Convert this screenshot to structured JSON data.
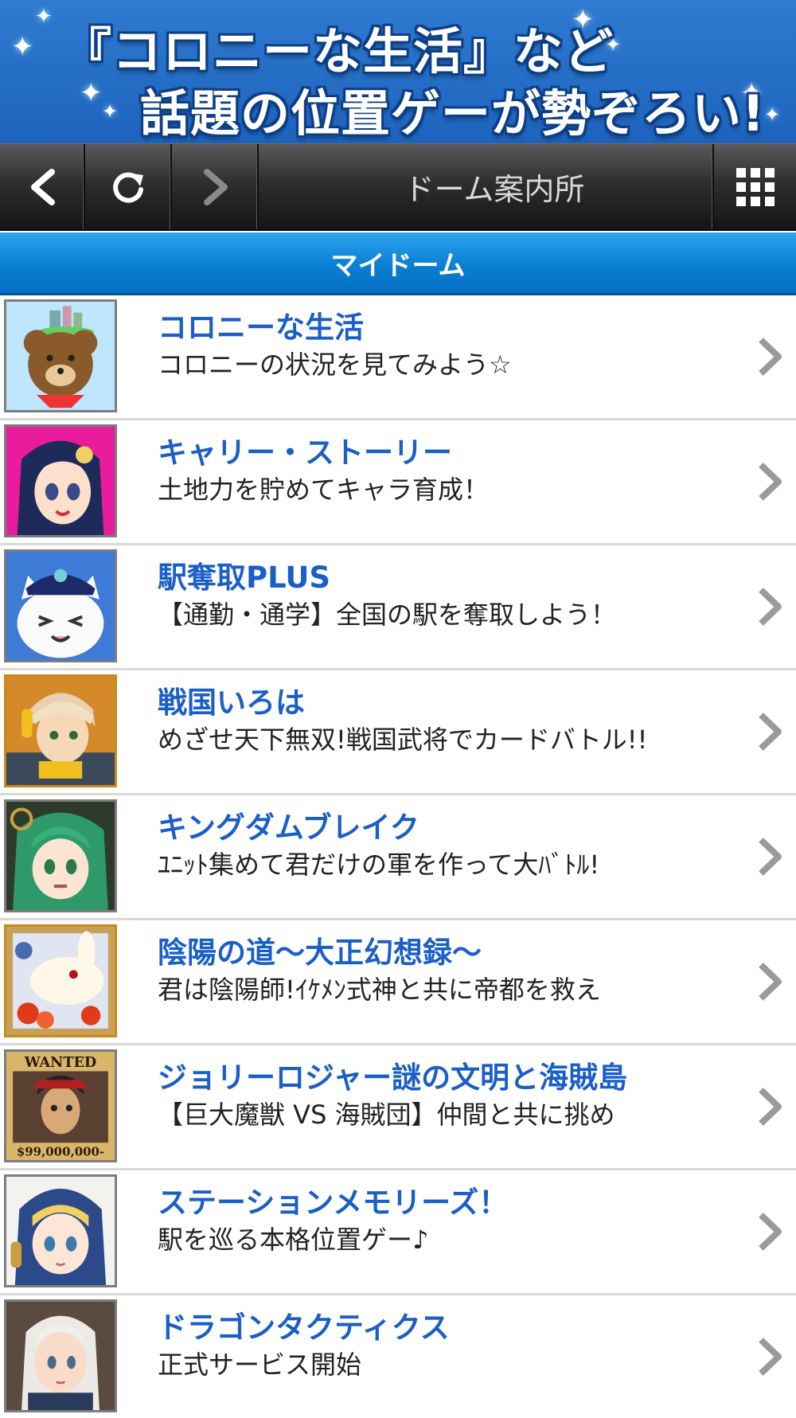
{
  "banner": {
    "line1": "『コロニーな生活』など",
    "line2": "話題の位置ゲーが勢ぞろい!"
  },
  "toolbar": {
    "back_icon": "back-arrow-icon",
    "reload_icon": "reload-icon",
    "forward_icon": "forward-arrow-icon",
    "title": "ドーム案内所",
    "menu_icon": "grid-menu-icon"
  },
  "section": {
    "title": "マイドーム"
  },
  "items": [
    {
      "title": "コロニーな生活",
      "desc": "コロニーの状況を見てみよう☆",
      "icon": "bear-colony-icon"
    },
    {
      "title": "キャリー・ストーリー",
      "desc": "土地力を貯めてキャラ育成！",
      "icon": "anime-girl-icon"
    },
    {
      "title": "駅奪取PLUS",
      "desc": "【通勤・通学】全国の駅を奪取しよう！",
      "icon": "cat-conductor-icon"
    },
    {
      "title": "戦国いろは",
      "desc": "めざせ天下無双!戦国武将でカードバトル!!",
      "icon": "warrior-boy-icon"
    },
    {
      "title": "キングダムブレイク",
      "desc": "ﾕﾆｯﾄ集めて君だけの軍を作って大ﾊﾞﾄﾙ!",
      "icon": "green-hair-girl-icon"
    },
    {
      "title": "陰陽の道〜大正幻想録〜",
      "desc": "君は陰陽師!ｲｹﾒﾝ式神と共に帝都を救え",
      "icon": "white-rabbit-icon"
    },
    {
      "title": "ジョリーロジャー謎の文明と海賊島",
      "desc": "【巨大魔獣 VS 海賊団】仲間と共に挑め",
      "icon": "wanted-pirate-icon",
      "poster_top": "WANTED",
      "poster_bottom": "$99,000,000-"
    },
    {
      "title": "ステーションメモリーズ！",
      "desc": "駅を巡る本格位置ゲー♪",
      "icon": "blue-hood-girl-icon"
    },
    {
      "title": "ドラゴンタクティクス",
      "desc": "正式サービス開始",
      "icon": "knight-woman-icon"
    }
  ],
  "colors": {
    "banner_bg": "#2f7bd0",
    "section_bg": "#0a7fd3",
    "title_text": "#1a5fc8"
  }
}
